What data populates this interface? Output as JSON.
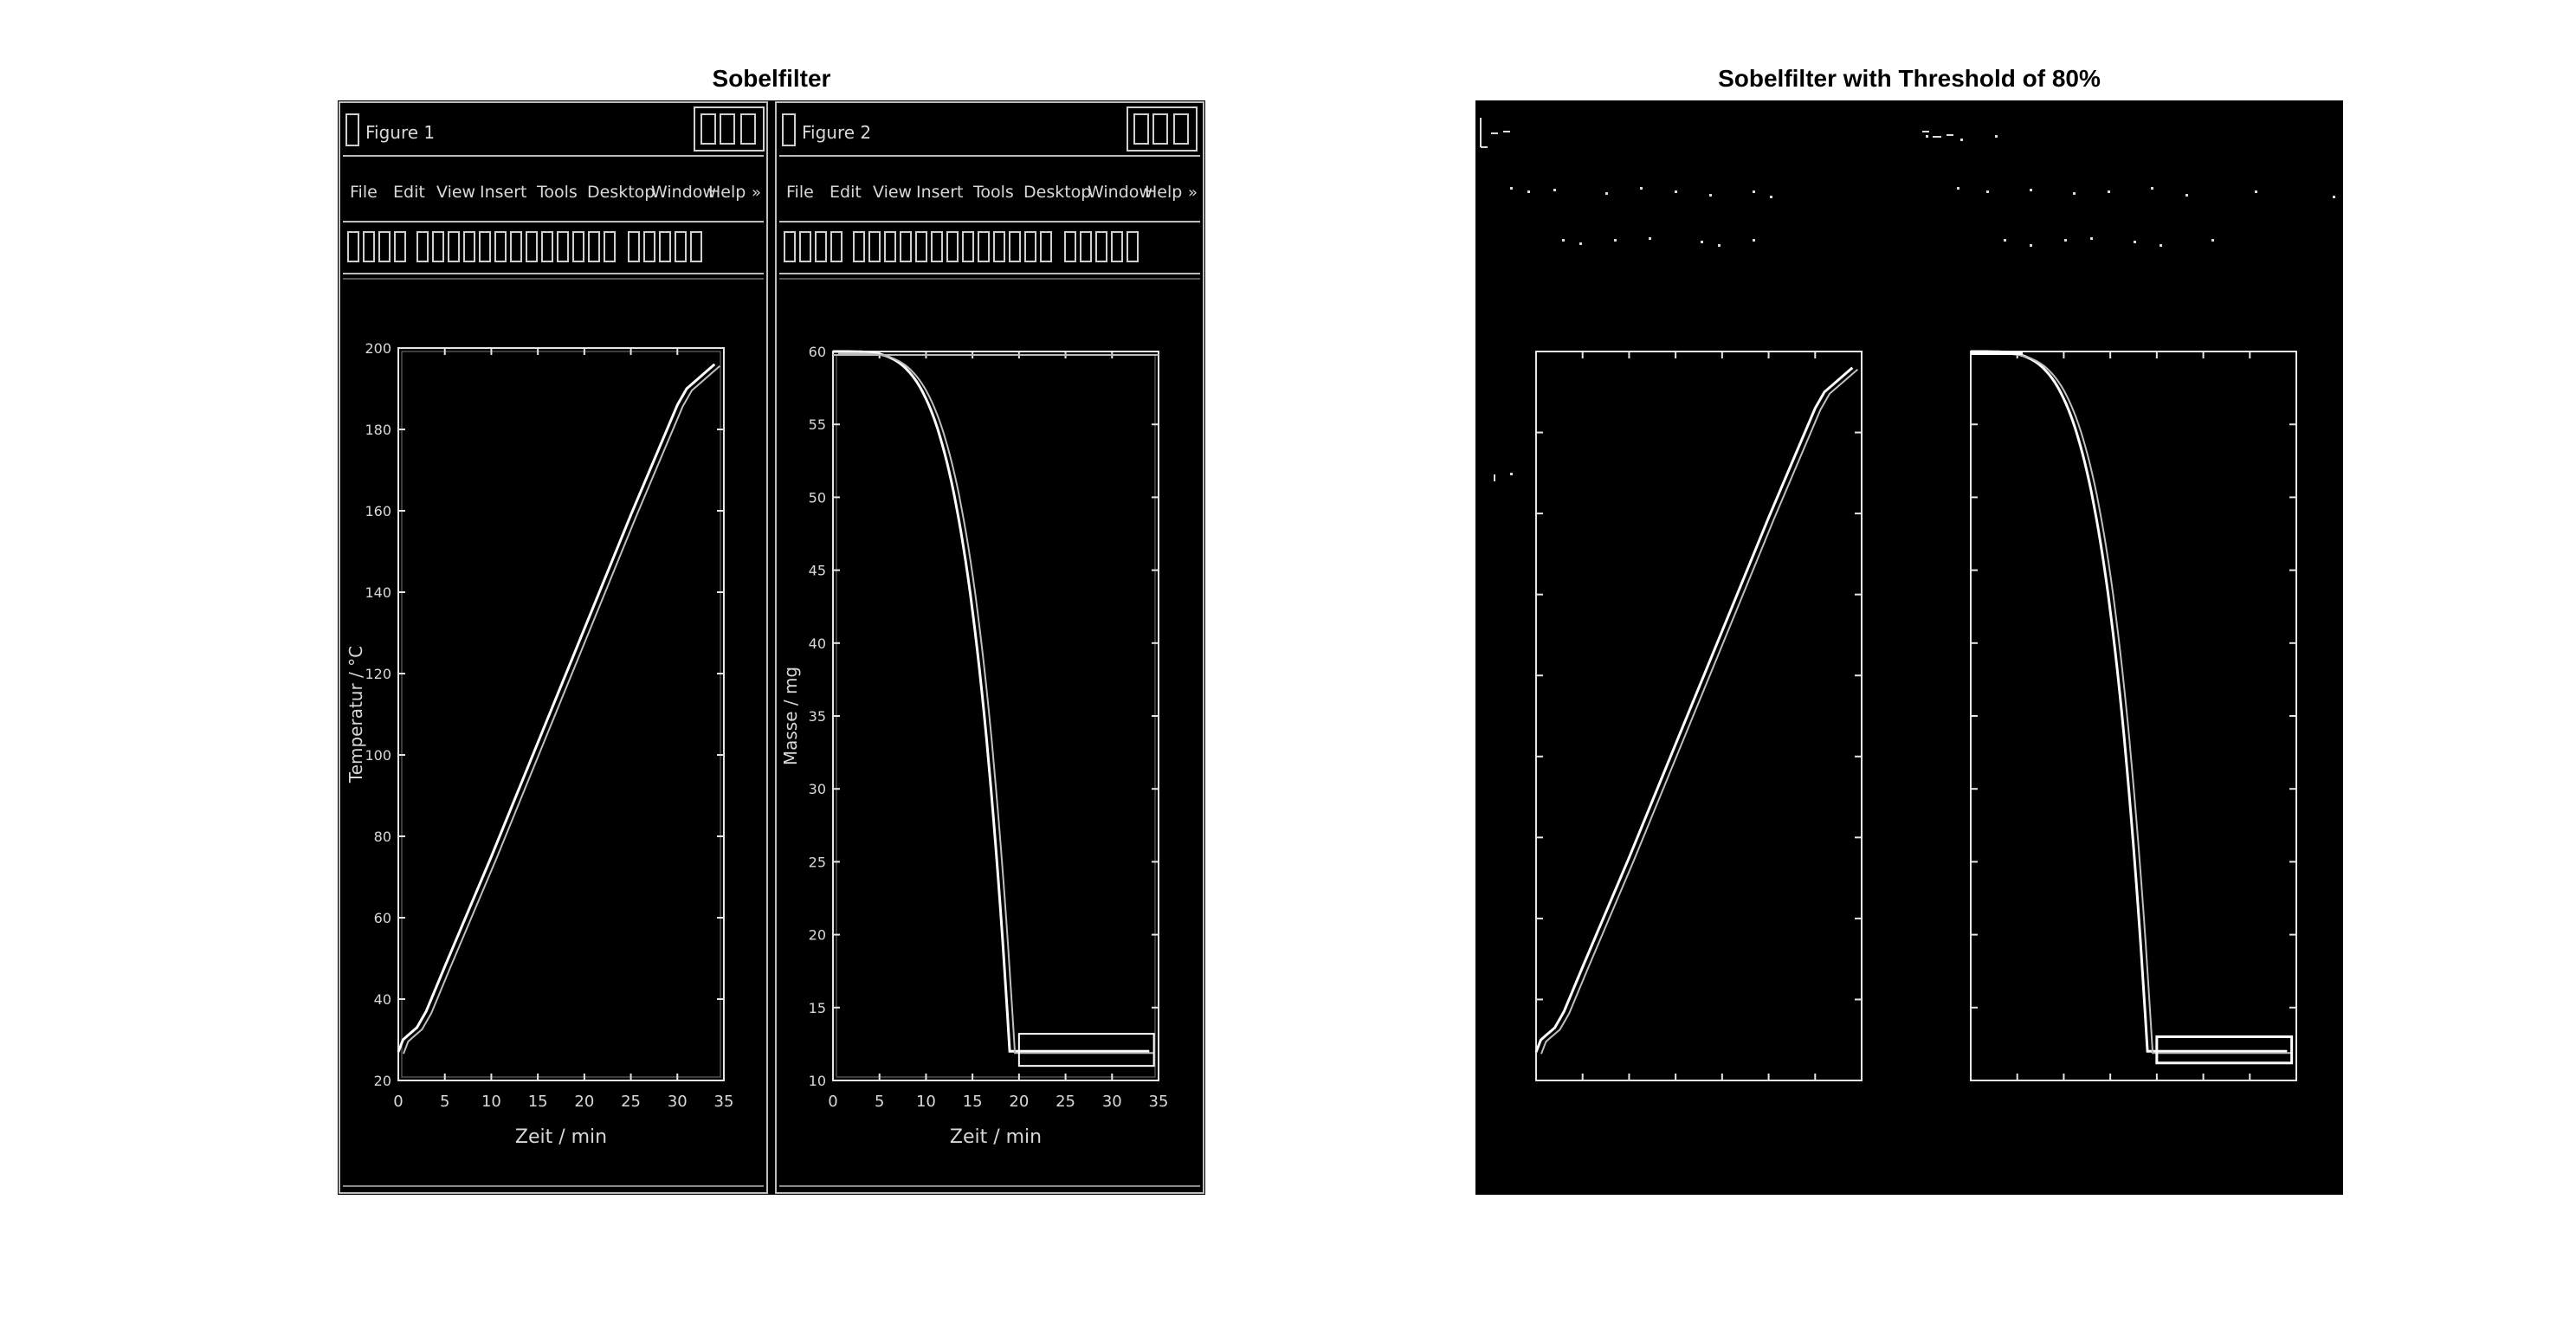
{
  "panels": [
    {
      "title": "Sobelfilter"
    },
    {
      "title": "Sobelfilter with Threshold of 80%"
    }
  ],
  "figure_windows": [
    {
      "window_title": "Figure 1",
      "menu": [
        "File",
        "Edit",
        "View",
        "Insert",
        "Tools",
        "Desktop",
        "Window",
        "Help"
      ],
      "xlabel": "Zeit / min",
      "ylabel": "Temperatur / °C",
      "xticks": [
        "0",
        "5",
        "10",
        "15",
        "20",
        "25",
        "30",
        "35"
      ],
      "yticks": [
        "20",
        "40",
        "60",
        "80",
        "100",
        "120",
        "140",
        "160",
        "180",
        "200"
      ]
    },
    {
      "window_title": "Figure 2",
      "menu": [
        "File",
        "Edit",
        "View",
        "Insert",
        "Tools",
        "Desktop",
        "Window",
        "Help"
      ],
      "xlabel": "Zeit / min",
      "ylabel": "Masse / mg",
      "xticks": [
        "0",
        "5",
        "10",
        "15",
        "20",
        "25",
        "30",
        "35"
      ],
      "yticks": [
        "10",
        "15",
        "20",
        "25",
        "30",
        "35",
        "40",
        "45",
        "50",
        "55",
        "60"
      ]
    }
  ],
  "plot_curves": {
    "temperature": {
      "x": [
        0,
        0.5,
        1,
        2,
        3,
        5,
        10,
        15,
        20,
        25,
        30,
        31,
        34
      ],
      "y": [
        27,
        30,
        31,
        33,
        37,
        48,
        75,
        103,
        131,
        159,
        186,
        190,
        196
      ]
    },
    "mass": {
      "x": [
        0,
        5,
        7,
        9,
        11,
        13,
        14,
        15,
        16,
        17,
        18,
        19,
        19.5,
        34
      ],
      "y": [
        60,
        60,
        59.5,
        58.5,
        56.5,
        53,
        50,
        46,
        41,
        34,
        24,
        12,
        12,
        12
      ]
    }
  },
  "icons": {
    "figure_window": "matlab-figure-icon",
    "minimize": "minimize-icon",
    "maximize": "maximize-icon",
    "close": "close-icon"
  },
  "colors": {
    "background": "#000000",
    "edge": "#ffffff",
    "page": "#ffffff",
    "title_text": "#000000"
  }
}
